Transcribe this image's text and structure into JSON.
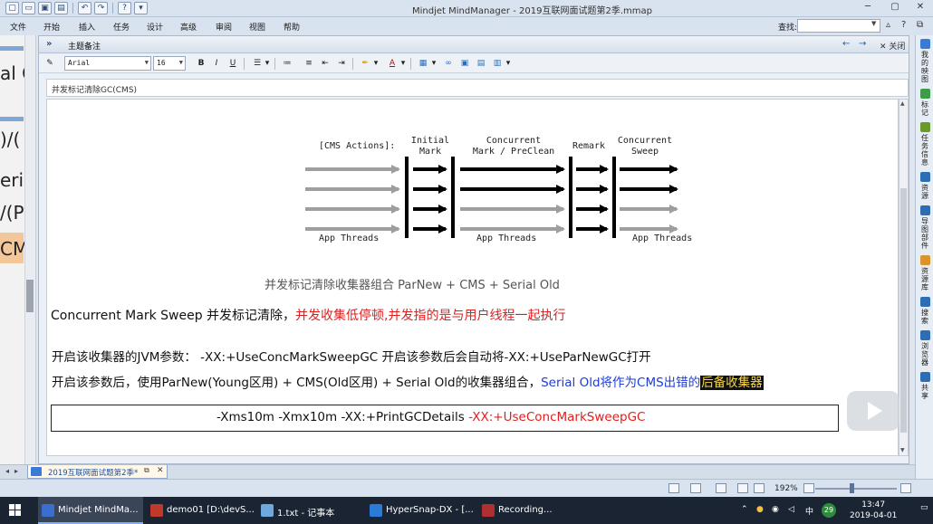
{
  "window": {
    "title": "Mindjet MindManager - 2019互联网面试题第2季.mmap",
    "controls": [
      "─",
      "▢",
      "✕"
    ]
  },
  "quick_access": [
    "new-icon",
    "open-icon",
    "save-icon",
    "print-icon",
    "undo-icon",
    "redo-icon",
    "help-icon",
    "customize-icon"
  ],
  "ribbon": {
    "tabs": [
      "文件",
      "开始",
      "插入",
      "任务",
      "设计",
      "高级",
      "审阅",
      "视图",
      "帮助"
    ],
    "find_label": "查找:",
    "find_value": ""
  },
  "left_strip": {
    "fragments": [
      "al C",
      ")/(",
      "eri",
      "/(P",
      "CM"
    ]
  },
  "notes_panel": {
    "collapse": "»",
    "title": "主题备注",
    "back": "←",
    "forward": "→",
    "close_label": "✕ 关闭"
  },
  "format_toolbar": {
    "font": "Arial",
    "size": "16",
    "bold": "B",
    "italic": "I",
    "underline": "U"
  },
  "subject": "并发标记清除GC(CMS)",
  "diagram": {
    "prefix": "[CMS Actions]:",
    "phases": [
      "Initial\nMark",
      "Concurrent\nMark / PreClean",
      "Remark",
      "Concurrent\nSweep"
    ],
    "threads": [
      "App Threads",
      "App Threads",
      "App Threads"
    ]
  },
  "content": {
    "caption": "并发标记清除收集器组合 ParNew + CMS + Serial Old",
    "line1_lead": "Concurrent Mark Sweep 并发标记清除，",
    "line1_red": "并发收集低停顿,并发指的是与用户线程一起执行",
    "line2": "开启该收集器的JVM参数：   -XX:+UseConcMarkSweepGC   开启该参数后会自动将-XX:+UseParNewGC打开",
    "line3_lead": "开启该参数后，使用ParNew(Young区用) + CMS(Old区用) + Serial Old的收集器组合，",
    "line3_blue": "Serial Old将作为CMS出错的",
    "line3_highlight": "后备收集器",
    "cmd_plain": "-Xms10m -Xmx10m -XX:+PrintGCDetails ",
    "cmd_red": "-XX:+UseConcMarkSweepGC"
  },
  "right_strip": [
    {
      "label": "我的映图",
      "icon": "map-icon",
      "color": "#3a7bd5"
    },
    {
      "label": "标记",
      "icon": "tag-icon",
      "color": "#3f9b4a"
    },
    {
      "label": "任务信息",
      "icon": "task-icon",
      "color": "#6a9a2a"
    },
    {
      "label": "资源",
      "icon": "resource-icon",
      "color": "#2c6db3"
    },
    {
      "label": "导图部件",
      "icon": "parts-icon",
      "color": "#2c6db3"
    },
    {
      "label": "资源库",
      "icon": "library-icon",
      "color": "#d8962a"
    },
    {
      "label": "搜索",
      "icon": "search-icon",
      "color": "#2c6db3"
    },
    {
      "label": "浏览器",
      "icon": "browser-icon",
      "color": "#2c6db3"
    },
    {
      "label": "共享",
      "icon": "share-icon",
      "color": "#2c6db3"
    }
  ],
  "doc_tab": {
    "label": "2019互联网面试题第2季*",
    "pin": "⧉",
    "close": "✕"
  },
  "status": {
    "zoom": "192%"
  },
  "taskbar": {
    "items": [
      {
        "label": "Mindjet MindMa...",
        "color": "#3a6fd0",
        "active": true
      },
      {
        "label": "demo01 [D:\\devS...",
        "color": "#c0392b",
        "active": false
      },
      {
        "label": "1.txt - 记事本",
        "color": "#6fa8dc",
        "active": false
      },
      {
        "label": "HyperSnap-DX - [...",
        "color": "#2b7bd8",
        "active": false
      },
      {
        "label": "Recording...",
        "color": "#b03030",
        "active": false
      }
    ],
    "tray_badge": "29",
    "ime": "中",
    "time": "13:47",
    "date": "2019-04-01"
  }
}
